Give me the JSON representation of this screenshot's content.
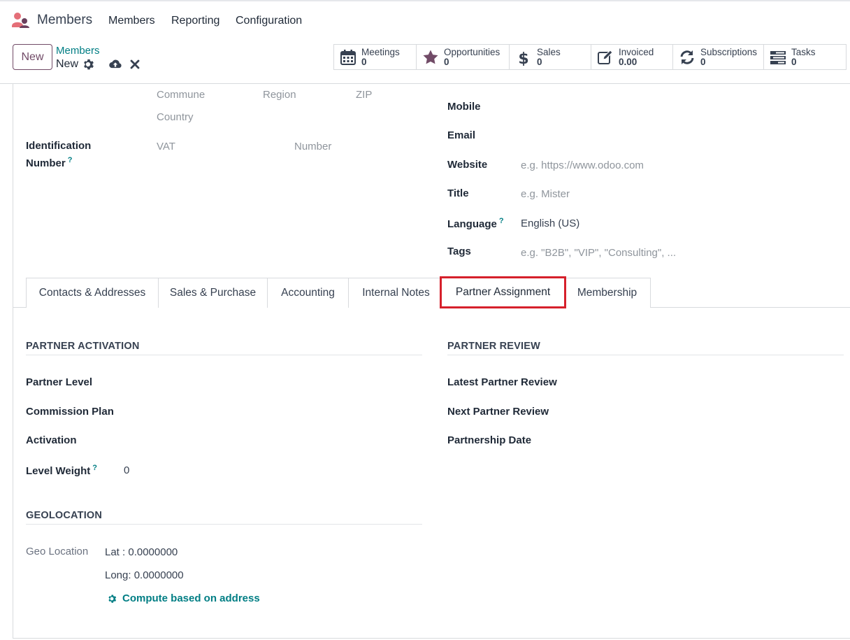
{
  "navbar": {
    "app_name": "Members",
    "menu": [
      "Members",
      "Reporting",
      "Configuration"
    ]
  },
  "control_panel": {
    "new_label": "New",
    "breadcrumb_parent": "Members",
    "breadcrumb_current": "New"
  },
  "smart_buttons": [
    {
      "label": "Meetings",
      "value": "0",
      "icon": "calendar-icon"
    },
    {
      "label": "Opportunities",
      "value": "0",
      "icon": "star-icon"
    },
    {
      "label": "Sales",
      "value": "0",
      "icon": "dollar-icon"
    },
    {
      "label": "Invoiced",
      "value": "0.00",
      "icon": "pencil-square-icon"
    },
    {
      "label": "Subscriptions",
      "value": "0",
      "icon": "refresh-icon"
    },
    {
      "label": "Tasks",
      "value": "0",
      "icon": "tasks-icon"
    }
  ],
  "address": {
    "commune_ph": "Commune",
    "region_ph": "Region",
    "zip_ph": "ZIP",
    "country_ph": "Country"
  },
  "identification": {
    "label_line1": "Identification",
    "label_line2": "Number",
    "help": "?",
    "vat_ph": "VAT",
    "number_ph": "Number"
  },
  "contact": {
    "mobile_label": "Mobile",
    "email_label": "Email",
    "website_label": "Website",
    "website_ph": "e.g. https://www.odoo.com",
    "title_label": "Title",
    "title_ph": "e.g. Mister",
    "language_label": "Language",
    "language_help": "?",
    "language_value": "English (US)",
    "tags_label": "Tags",
    "tags_ph": "e.g. \"B2B\", \"VIP\", \"Consulting\", ..."
  },
  "tabs": [
    {
      "label": "Contacts & Addresses"
    },
    {
      "label": "Sales & Purchase"
    },
    {
      "label": "Accounting"
    },
    {
      "label": "Internal Notes"
    },
    {
      "label": "Partner Assignment",
      "active": true
    },
    {
      "label": "Membership"
    }
  ],
  "partner_activation": {
    "title": "PARTNER ACTIVATION",
    "partner_level": "Partner Level",
    "commission_plan": "Commission Plan",
    "activation": "Activation",
    "level_weight": "Level Weight",
    "level_weight_help": "?",
    "level_weight_value": "0"
  },
  "partner_review": {
    "title": "PARTNER REVIEW",
    "latest": "Latest Partner Review",
    "next": "Next Partner Review",
    "partnership_date": "Partnership Date"
  },
  "geolocation": {
    "title": "GEOLOCATION",
    "label": "Geo Location",
    "lat": "Lat : 0.0000000",
    "long": "Long: 0.0000000",
    "compute_link": "Compute based on address"
  },
  "colors": {
    "brand": "#714b67",
    "link": "#017e84",
    "highlight": "#d6202b"
  }
}
